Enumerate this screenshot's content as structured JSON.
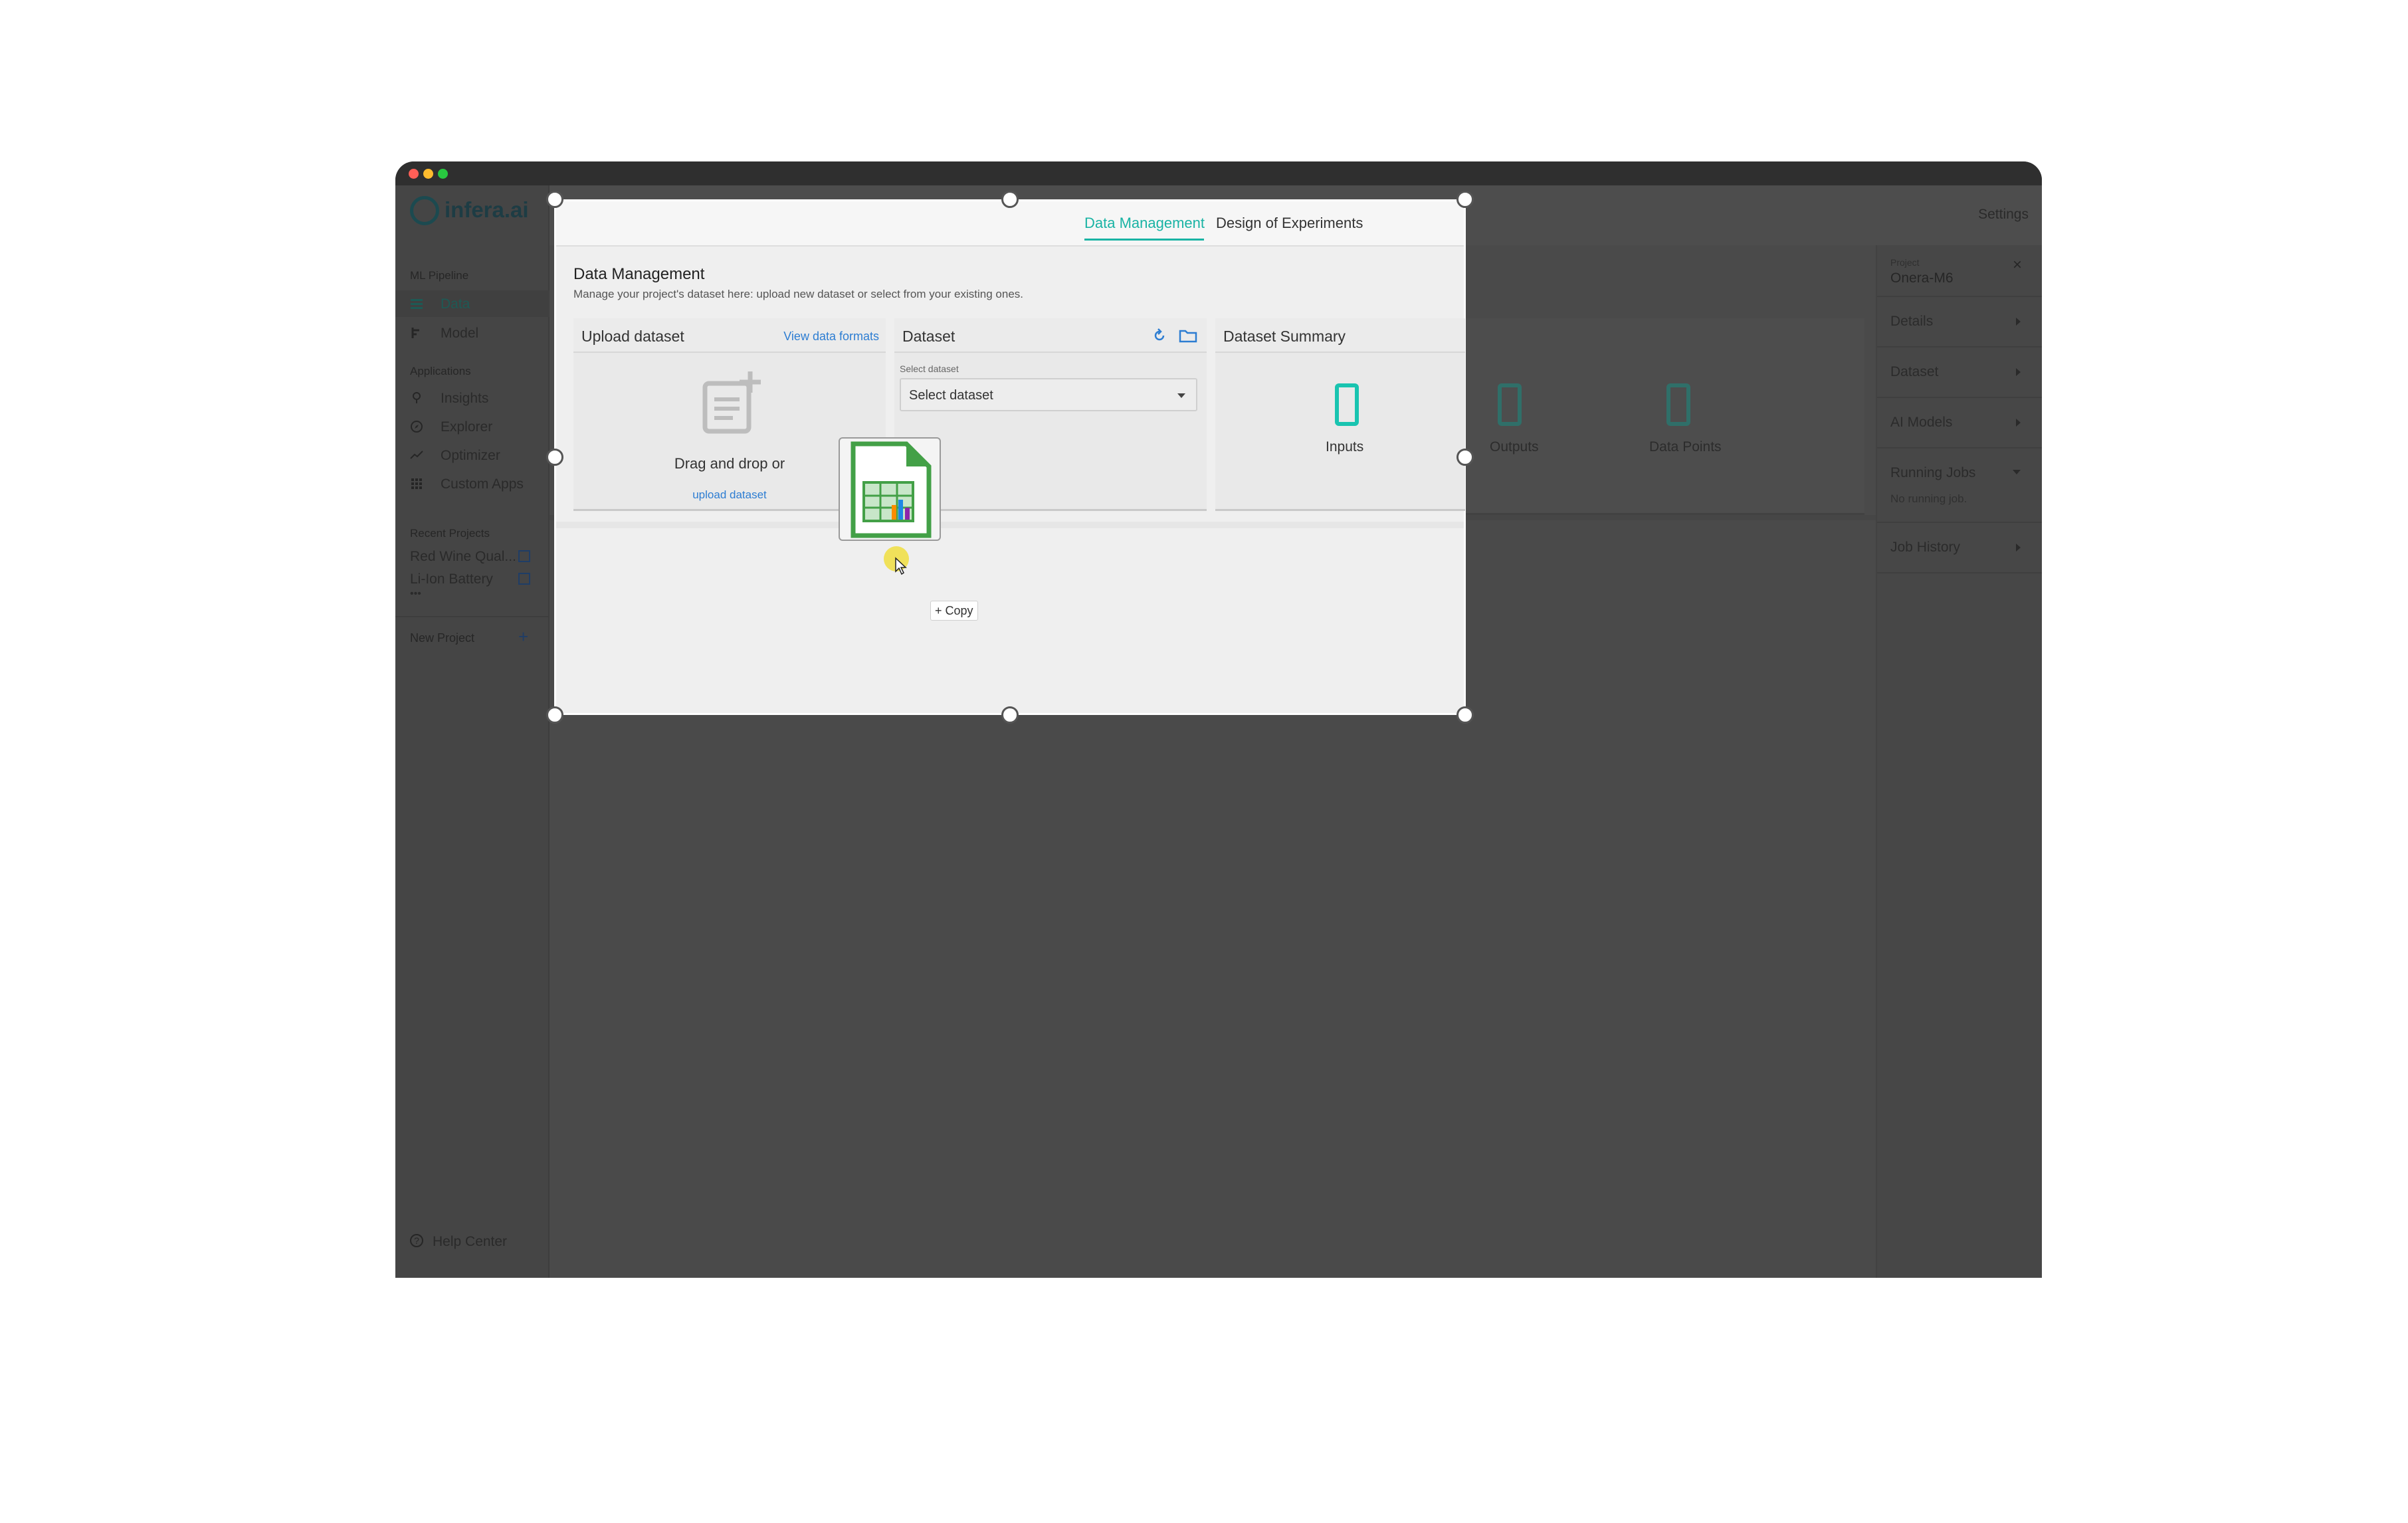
{
  "app": {
    "brand": "infera.ai",
    "settings_label": "Settings"
  },
  "sidebar": {
    "sections": {
      "pipeline": "ML Pipeline",
      "applications": "Applications",
      "recent": "Recent Projects"
    },
    "pipeline_items": [
      {
        "label": "Data",
        "icon": "table-icon",
        "active": true
      },
      {
        "label": "Model",
        "icon": "tree-icon"
      }
    ],
    "app_items": [
      {
        "label": "Insights",
        "icon": "bulb-icon"
      },
      {
        "label": "Explorer",
        "icon": "compass-icon"
      },
      {
        "label": "Optimizer",
        "icon": "trend-icon"
      },
      {
        "label": "Custom Apps",
        "icon": "grid-icon"
      }
    ],
    "recent_projects": [
      {
        "label": "Red Wine Qual..."
      },
      {
        "label": "Li-Ion Battery"
      }
    ],
    "more": "•••",
    "new_project": "New Project",
    "help": "Help Center"
  },
  "right_panel": {
    "project_caption": "Project",
    "project_name": "Onera-M6",
    "items": [
      {
        "label": "Details"
      },
      {
        "label": "Dataset"
      },
      {
        "label": "AI Models"
      },
      {
        "label": "Running Jobs"
      },
      {
        "label": "Job History"
      }
    ],
    "running_empty": "No running job."
  },
  "tabs": [
    {
      "label": "Data Management",
      "active": true
    },
    {
      "label": "Design of Experiments",
      "active": false
    }
  ],
  "data_management": {
    "title": "Data Management",
    "subtitle": "Manage your project's dataset here: upload new dataset or select from your existing ones."
  },
  "upload": {
    "title": "Upload dataset",
    "formats_link": "View data formats",
    "drag_text": "Drag and drop or",
    "upload_link": "upload dataset"
  },
  "dataset": {
    "title": "Dataset",
    "select_caption": "Select dataset",
    "select_value": "Select dataset"
  },
  "summary": {
    "title": "Dataset Summary",
    "stats": [
      {
        "value": "0",
        "label": "Inputs"
      },
      {
        "value": "0",
        "label": "Outputs"
      },
      {
        "value": "0",
        "label": "Data Points"
      }
    ]
  },
  "drag": {
    "copy_label": "+ Copy"
  },
  "colors": {
    "accent": "#19c4b0",
    "link": "#2d7dd2",
    "window_bg": "#4a4a4a"
  }
}
